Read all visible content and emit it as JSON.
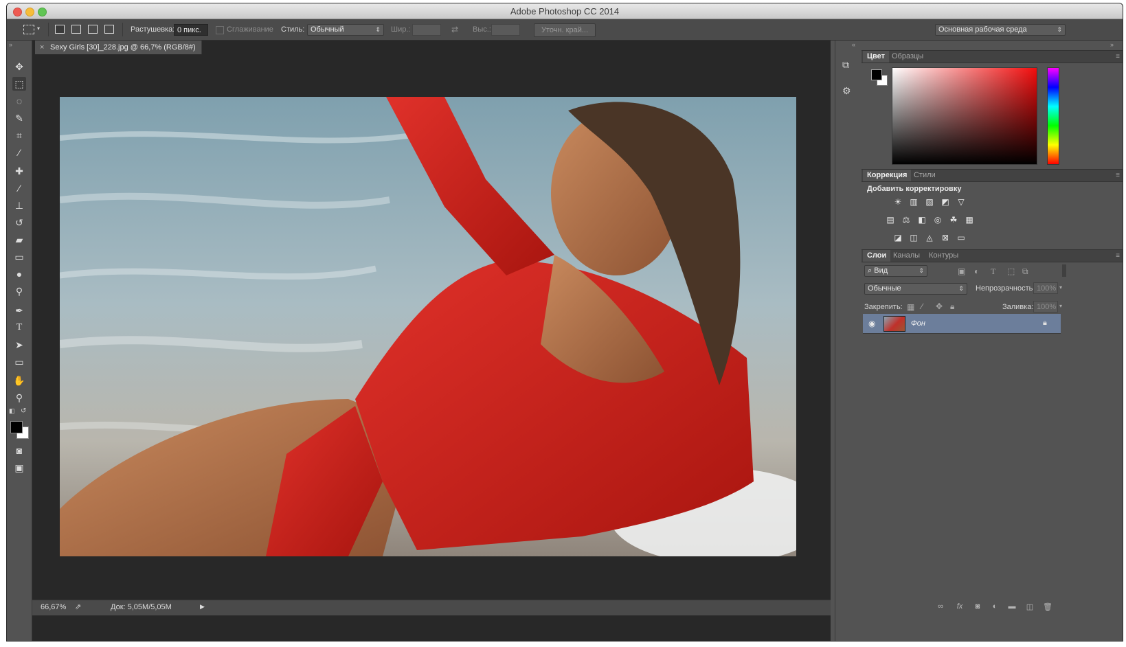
{
  "app": {
    "title": "Adobe Photoshop CC 2014"
  },
  "options": {
    "feather_label": "Растушевка:",
    "feather_value": "0 пикс.",
    "antialias_label": "Сглаживание",
    "style_label": "Стиль:",
    "style_value": "Обычный",
    "width_label": "Шир.:",
    "height_label": "Выс.:",
    "refine_edge": "Уточн. край...",
    "workspace": "Основная рабочая среда"
  },
  "document": {
    "tab_label": "Sexy Girls [30]_228.jpg @ 66,7% (RGB/8#)",
    "zoom": "66,67%",
    "doc_size": "Док: 5,05M/5,05M"
  },
  "panels": {
    "color_tab": "Цвет",
    "swatches_tab": "Образцы",
    "adjust_tab": "Коррекция",
    "styles_tab": "Стили",
    "add_adjustment": "Добавить корректировку",
    "layers_tab": "Слои",
    "channels_tab": "Каналы",
    "paths_tab": "Контуры",
    "filter_kind": "Вид",
    "blend_mode": "Обычные",
    "opacity_label": "Непрозрачность:",
    "opacity_value": "100%",
    "lock_label": "Закрепить:",
    "fill_label": "Заливка:",
    "fill_value": "100%",
    "layer_name": "Фон"
  },
  "colors": {
    "foreground": "#000000",
    "background": "#ffffff",
    "selected_layer": "#6c7e9b",
    "panel_bg": "#535353"
  }
}
